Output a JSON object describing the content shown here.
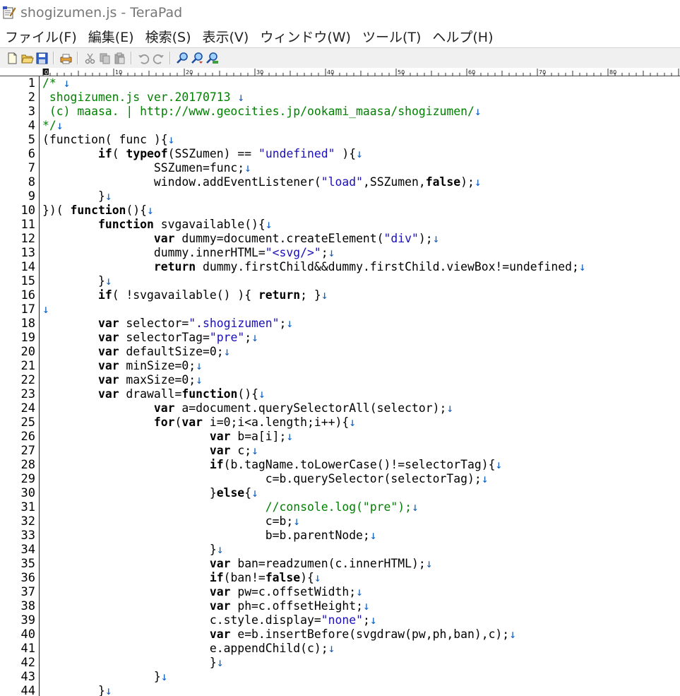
{
  "window": {
    "title": "shogizumen.js - TeraPad"
  },
  "menu": [
    "ファイル(F)",
    "編集(E)",
    "検索(S)",
    "表示(V)",
    "ウィンドウ(W)",
    "ツール(T)",
    "ヘルプ(H)"
  ],
  "toolbar": [
    {
      "name": "new-file-icon"
    },
    {
      "name": "open-folder-icon"
    },
    {
      "name": "save-icon"
    },
    {
      "sep": true
    },
    {
      "name": "print-icon"
    },
    {
      "sep": true
    },
    {
      "name": "cut-icon"
    },
    {
      "name": "copy-icon"
    },
    {
      "name": "paste-icon"
    },
    {
      "sep": true
    },
    {
      "name": "undo-icon"
    },
    {
      "name": "redo-icon"
    },
    {
      "sep": true
    },
    {
      "name": "find-icon"
    },
    {
      "name": "find-next-icon"
    },
    {
      "name": "replace-icon"
    }
  ],
  "ruler": {
    "labels": [
      "0",
      "10",
      "20",
      "30",
      "40",
      "50",
      "60",
      "70",
      "80"
    ]
  },
  "editor": {
    "eol_mark": "↓",
    "lines": [
      {
        "n": 1,
        "t": [
          {
            "c": "cm",
            "s": "/* "
          }
        ],
        "eol": true
      },
      {
        "n": 2,
        "t": [
          {
            "c": "cm",
            "s": " shogizumen.js ver.20170713 "
          }
        ],
        "eol": true
      },
      {
        "n": 3,
        "t": [
          {
            "c": "cm",
            "s": " (c) maasa. | http://www.geocities.jp/ookami_maasa/shogizumen/"
          }
        ],
        "eol": true
      },
      {
        "n": 4,
        "t": [
          {
            "c": "cm",
            "s": "*/"
          }
        ],
        "eol": true
      },
      {
        "n": 5,
        "t": [
          {
            "s": "(function( func ){"
          }
        ],
        "eol": true
      },
      {
        "n": 6,
        "t": [
          {
            "s": "\t"
          },
          {
            "c": "kw",
            "s": "if"
          },
          {
            "s": "( "
          },
          {
            "c": "kw",
            "s": "typeof"
          },
          {
            "s": "(SSZumen) == "
          },
          {
            "c": "st",
            "s": "\"undefined\""
          },
          {
            "s": " ){"
          }
        ],
        "eol": true
      },
      {
        "n": 7,
        "t": [
          {
            "s": "\t\tSSZumen=func;"
          }
        ],
        "eol": true
      },
      {
        "n": 8,
        "t": [
          {
            "s": "\t\twindow.addEventListener("
          },
          {
            "c": "st",
            "s": "\"load\""
          },
          {
            "s": ",SSZumen,"
          },
          {
            "c": "kw",
            "s": "false"
          },
          {
            "s": ");"
          }
        ],
        "eol": true
      },
      {
        "n": 9,
        "t": [
          {
            "s": "\t}"
          }
        ],
        "eol": true
      },
      {
        "n": 10,
        "t": [
          {
            "s": "})( "
          },
          {
            "c": "kw",
            "s": "function"
          },
          {
            "s": "(){"
          }
        ],
        "eol": true
      },
      {
        "n": 11,
        "t": [
          {
            "s": "\t"
          },
          {
            "c": "kw",
            "s": "function"
          },
          {
            "s": " svgavailable(){"
          }
        ],
        "eol": true
      },
      {
        "n": 12,
        "t": [
          {
            "s": "\t\t"
          },
          {
            "c": "kw",
            "s": "var"
          },
          {
            "s": " dummy=document.createElement("
          },
          {
            "c": "st",
            "s": "\"div\""
          },
          {
            "s": ");"
          }
        ],
        "eol": true
      },
      {
        "n": 13,
        "t": [
          {
            "s": "\t\tdummy.innerHTML="
          },
          {
            "c": "st",
            "s": "\"<svg/>\""
          },
          {
            "s": ";"
          }
        ],
        "eol": true
      },
      {
        "n": 14,
        "t": [
          {
            "s": "\t\t"
          },
          {
            "c": "kw",
            "s": "return"
          },
          {
            "s": " dummy.firstChild&&dummy.firstChild.viewBox!=undefined;"
          }
        ],
        "eol": true
      },
      {
        "n": 15,
        "t": [
          {
            "s": "\t}"
          }
        ],
        "eol": true
      },
      {
        "n": 16,
        "t": [
          {
            "s": "\t"
          },
          {
            "c": "kw",
            "s": "if"
          },
          {
            "s": "( !svgavailable() ){ "
          },
          {
            "c": "kw",
            "s": "return"
          },
          {
            "s": "; }"
          }
        ],
        "eol": true
      },
      {
        "n": 17,
        "t": [],
        "eol": true
      },
      {
        "n": 18,
        "t": [
          {
            "s": "\t"
          },
          {
            "c": "kw",
            "s": "var"
          },
          {
            "s": " selector="
          },
          {
            "c": "st",
            "s": "\".shogizumen\""
          },
          {
            "s": ";"
          }
        ],
        "eol": true
      },
      {
        "n": 19,
        "t": [
          {
            "s": "\t"
          },
          {
            "c": "kw",
            "s": "var"
          },
          {
            "s": " selectorTag="
          },
          {
            "c": "st",
            "s": "\"pre\""
          },
          {
            "s": ";"
          }
        ],
        "eol": true
      },
      {
        "n": 20,
        "t": [
          {
            "s": "\t"
          },
          {
            "c": "kw",
            "s": "var"
          },
          {
            "s": " defaultSize=0;"
          }
        ],
        "eol": true
      },
      {
        "n": 21,
        "t": [
          {
            "s": "\t"
          },
          {
            "c": "kw",
            "s": "var"
          },
          {
            "s": " minSize=0;"
          }
        ],
        "eol": true
      },
      {
        "n": 22,
        "t": [
          {
            "s": "\t"
          },
          {
            "c": "kw",
            "s": "var"
          },
          {
            "s": " maxSize=0;"
          }
        ],
        "eol": true
      },
      {
        "n": 23,
        "t": [
          {
            "s": "\t"
          },
          {
            "c": "kw",
            "s": "var"
          },
          {
            "s": " drawall="
          },
          {
            "c": "kw",
            "s": "function"
          },
          {
            "s": "(){"
          }
        ],
        "eol": true
      },
      {
        "n": 24,
        "t": [
          {
            "s": "\t\t"
          },
          {
            "c": "kw",
            "s": "var"
          },
          {
            "s": " a=document.querySelectorAll(selector);"
          }
        ],
        "eol": true
      },
      {
        "n": 25,
        "t": [
          {
            "s": "\t\t"
          },
          {
            "c": "kw",
            "s": "for"
          },
          {
            "s": "("
          },
          {
            "c": "kw",
            "s": "var"
          },
          {
            "s": " i=0;i<a.length;i++){"
          }
        ],
        "eol": true
      },
      {
        "n": 26,
        "t": [
          {
            "s": "\t\t\t"
          },
          {
            "c": "kw",
            "s": "var"
          },
          {
            "s": " b=a[i];"
          }
        ],
        "eol": true
      },
      {
        "n": 27,
        "t": [
          {
            "s": "\t\t\t"
          },
          {
            "c": "kw",
            "s": "var"
          },
          {
            "s": " c;"
          }
        ],
        "eol": true
      },
      {
        "n": 28,
        "t": [
          {
            "s": "\t\t\t"
          },
          {
            "c": "kw",
            "s": "if"
          },
          {
            "s": "(b.tagName.toLowerCase()!=selectorTag){"
          }
        ],
        "eol": true
      },
      {
        "n": 29,
        "t": [
          {
            "s": "\t\t\t\tc=b.querySelector(selectorTag);"
          }
        ],
        "eol": true
      },
      {
        "n": 30,
        "t": [
          {
            "s": "\t\t\t}"
          },
          {
            "c": "kw",
            "s": "else"
          },
          {
            "s": "{"
          }
        ],
        "eol": true
      },
      {
        "n": 31,
        "t": [
          {
            "s": "\t\t\t\t"
          },
          {
            "c": "cm",
            "s": "//console.log(\"pre\");"
          }
        ],
        "eol": true
      },
      {
        "n": 32,
        "t": [
          {
            "s": "\t\t\t\tc=b;"
          }
        ],
        "eol": true
      },
      {
        "n": 33,
        "t": [
          {
            "s": "\t\t\t\tb=b.parentNode;"
          }
        ],
        "eol": true
      },
      {
        "n": 34,
        "t": [
          {
            "s": "\t\t\t}"
          }
        ],
        "eol": true
      },
      {
        "n": 35,
        "t": [
          {
            "s": "\t\t\t"
          },
          {
            "c": "kw",
            "s": "var"
          },
          {
            "s": " ban=readzumen(c.innerHTML);"
          }
        ],
        "eol": true
      },
      {
        "n": 36,
        "t": [
          {
            "s": "\t\t\t"
          },
          {
            "c": "kw",
            "s": "if"
          },
          {
            "s": "(ban!="
          },
          {
            "c": "kw",
            "s": "false"
          },
          {
            "s": "){"
          }
        ],
        "eol": true
      },
      {
        "n": 37,
        "t": [
          {
            "s": "\t\t\t"
          },
          {
            "c": "kw",
            "s": "var"
          },
          {
            "s": " pw=c.offsetWidth;"
          }
        ],
        "eol": true
      },
      {
        "n": 38,
        "t": [
          {
            "s": "\t\t\t"
          },
          {
            "c": "kw",
            "s": "var"
          },
          {
            "s": " ph=c.offsetHeight;"
          }
        ],
        "eol": true
      },
      {
        "n": 39,
        "t": [
          {
            "s": "\t\t\tc.style.display="
          },
          {
            "c": "st",
            "s": "\"none\""
          },
          {
            "s": ";"
          }
        ],
        "eol": true
      },
      {
        "n": 40,
        "t": [
          {
            "s": "\t\t\t"
          },
          {
            "c": "kw",
            "s": "var"
          },
          {
            "s": " e=b.insertBefore(svgdraw(pw,ph,ban),c);"
          }
        ],
        "eol": true
      },
      {
        "n": 41,
        "t": [
          {
            "s": "\t\t\te.appendChild(c);"
          }
        ],
        "eol": true
      },
      {
        "n": 42,
        "t": [
          {
            "s": "\t\t\t}"
          }
        ],
        "eol": true
      },
      {
        "n": 43,
        "t": [
          {
            "s": "\t\t}"
          }
        ],
        "eol": true
      },
      {
        "n": 44,
        "t": [
          {
            "s": "\t}"
          }
        ],
        "eol": true
      }
    ]
  }
}
